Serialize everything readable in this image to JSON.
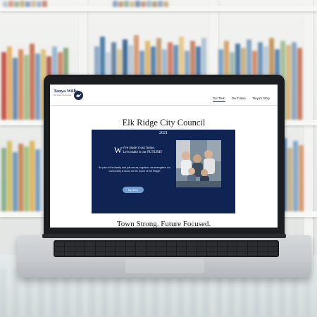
{
  "site": {
    "brand_name": "Tanya Willis",
    "brand_tagline": "Our Town. Our Future.",
    "brand_logo_icon": "bird-logo-icon",
    "nav": [
      {
        "label": "Our Town",
        "active": true
      },
      {
        "label": "Our Future",
        "active": false
      },
      {
        "label": "Tanya's Story",
        "active": false
      }
    ]
  },
  "page": {
    "title": "Elk Ridge City Council",
    "hero": {
      "year": "2021",
      "heading_dropcap": "W",
      "heading_line1": "e've made it our home,",
      "heading_line2": "Let's make it our FUTURE!",
      "body": "Be part of the family and join me as, together, we strengthen our community & focus on the future of Elk Ridge!",
      "button_label": "My Story",
      "photo_icon": "family-photo"
    },
    "tagline": "Town Strong. Future Focused."
  },
  "colors": {
    "brand_navy": "#1d2a55",
    "hero_bg": "#102454",
    "button_bg": "#6f9ed0"
  }
}
